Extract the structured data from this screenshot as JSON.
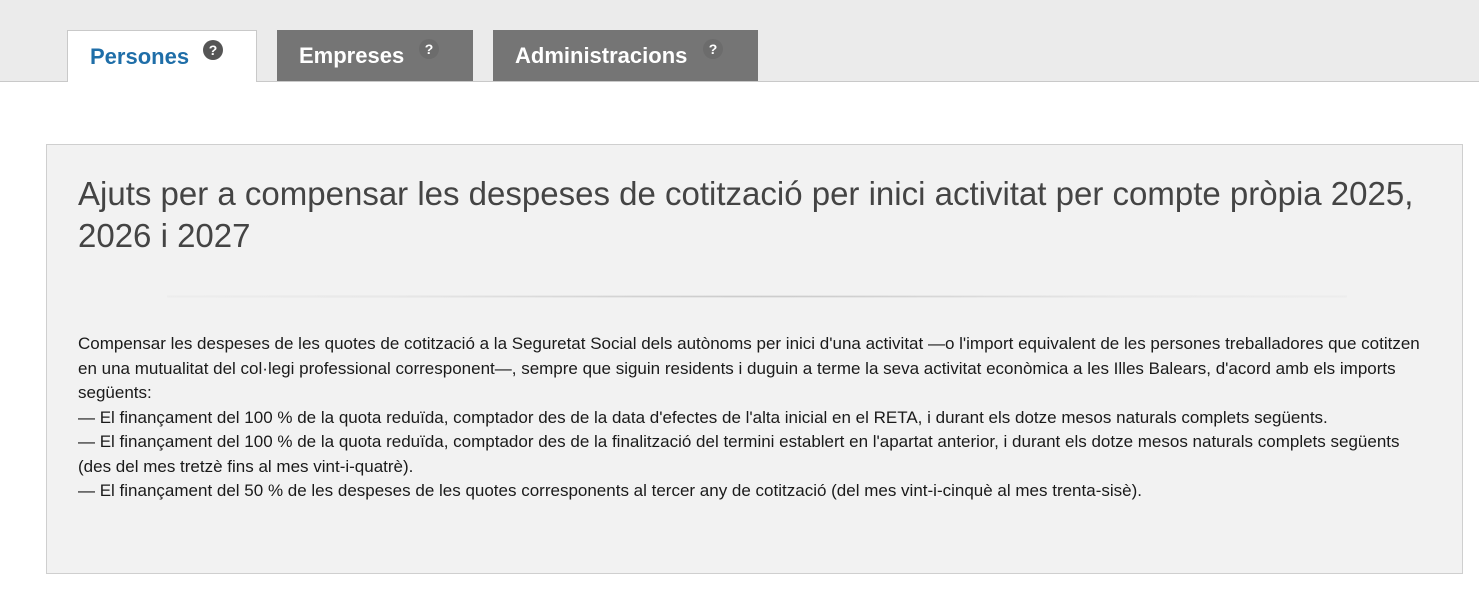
{
  "tabs": [
    {
      "label": "Persones",
      "help": "?",
      "active": true
    },
    {
      "label": "Empreses",
      "help": "?",
      "active": false
    },
    {
      "label": "Administracions",
      "help": "?",
      "active": false
    }
  ],
  "content": {
    "title": "Ajuts per a compensar les despeses de cotització per inici activitat per compte pròpia 2025, 2026 i 2027",
    "intro": "Compensar les despeses de les quotes de cotització a la Seguretat Social dels autònoms per inici d'una activitat —o l'import equivalent de les persones treballadores que cotitzen en una mutualitat del col·legi professional corresponent—, sempre que siguin residents i duguin a terme la seva activitat econòmica a les Illes Balears, d'acord amb els imports següents:",
    "items": [
      "— El finançament del 100 % de la quota reduïda, comptador des de la data d'efectes de l'alta inicial en el RETA, i durant els dotze mesos naturals complets següents.",
      "— El finançament del 100 % de la quota reduïda, comptador des de la finalització del termini establert en l'apartat anterior, i durant els dotze mesos naturals complets següents (des del mes tretzè fins al mes vint-i-quatrè).",
      "— El finançament del 50 % de les despeses de les quotes corresponents al tercer any de cotització (del mes vint-i-cinquè al mes trenta-sisè)."
    ]
  },
  "colors": {
    "active_tab_text": "#1f6ea8",
    "inactive_tab_bg": "#757575",
    "tabbar_bg": "#ebebeb",
    "panel_bg": "#f2f2f2",
    "title_text": "#444444"
  }
}
